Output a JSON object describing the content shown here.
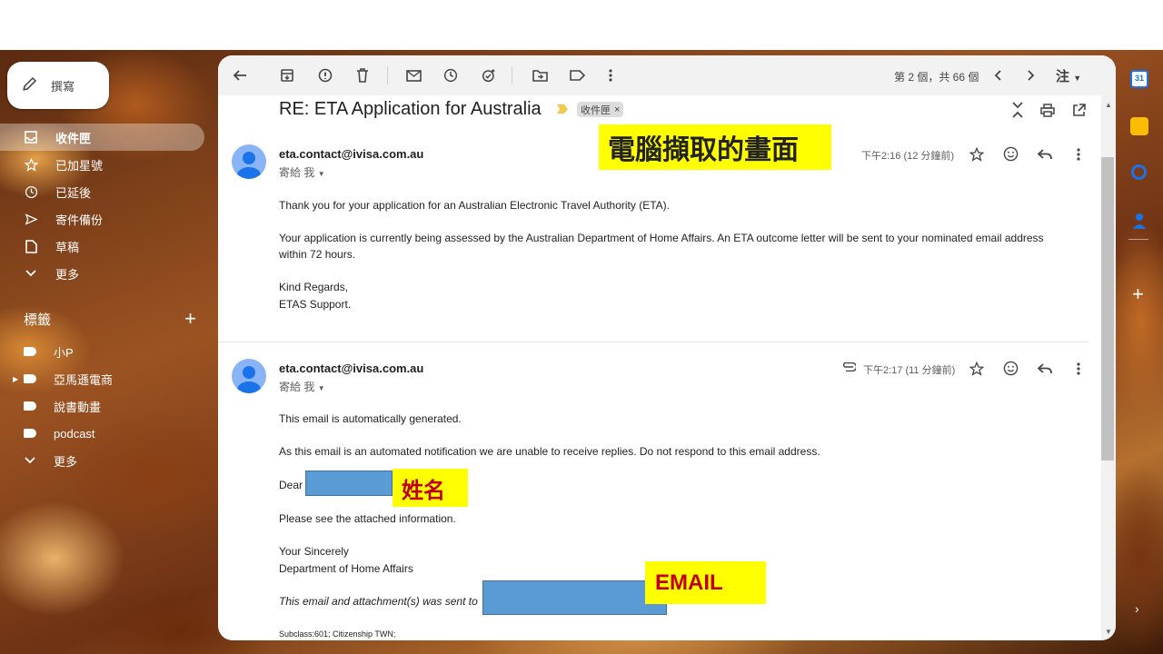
{
  "compose": {
    "label": "撰寫"
  },
  "nav": [
    {
      "label": "收件匣",
      "icon": "inbox-icon"
    },
    {
      "label": "已加星號",
      "icon": "star-icon"
    },
    {
      "label": "已延後",
      "icon": "clock-icon"
    },
    {
      "label": "寄件備份",
      "icon": "send-icon"
    },
    {
      "label": "草稿",
      "icon": "draft-icon"
    },
    {
      "label": "更多",
      "icon": "chevron-down-icon"
    }
  ],
  "labels": {
    "heading": "標籤",
    "items": [
      "小P",
      "亞馬遜電商",
      "說書動畫",
      "podcast"
    ],
    "more": "更多"
  },
  "toolbar": {
    "pager": "第 2 個，共 66 個",
    "account": "注"
  },
  "thread": {
    "subject": "RE: ETA Application for Australia",
    "chip": "收件匣",
    "annotation": "電腦擷取的畫面"
  },
  "messages": [
    {
      "sender": "eta.contact@ivisa.com.au",
      "to": "寄給 我",
      "time": "下午2:16 (12 分鐘前)",
      "lines": [
        "Thank you for your application for an Australian Electronic Travel Authority (ETA).",
        "Your application is currently being assessed by the Australian Department of Home Affairs. An ETA outcome letter will be sent to your nominated email address",
        "within 72 hours.",
        "Kind Regards,",
        "ETAS Support."
      ]
    },
    {
      "sender": "eta.contact@ivisa.com.au",
      "to": "寄給 我",
      "time": "下午2:17 (11 分鐘前)",
      "lines": [
        "This email is automatically generated.",
        "As this email is an automated notification we are unable to receive replies. Do not respond to this email address.",
        "Dear",
        "Please see the attached information.",
        "Your Sincerely",
        "Department of Home Affairs",
        "This email and attachment(s) was sent to",
        "Subclass:601; Citizenship TWN;"
      ],
      "name_note": "姓名",
      "email_note": "EMAIL"
    }
  ],
  "colors": {
    "accent": "#0b57d0",
    "highlight": "#ffff00",
    "redact": "#5b9bd5"
  }
}
